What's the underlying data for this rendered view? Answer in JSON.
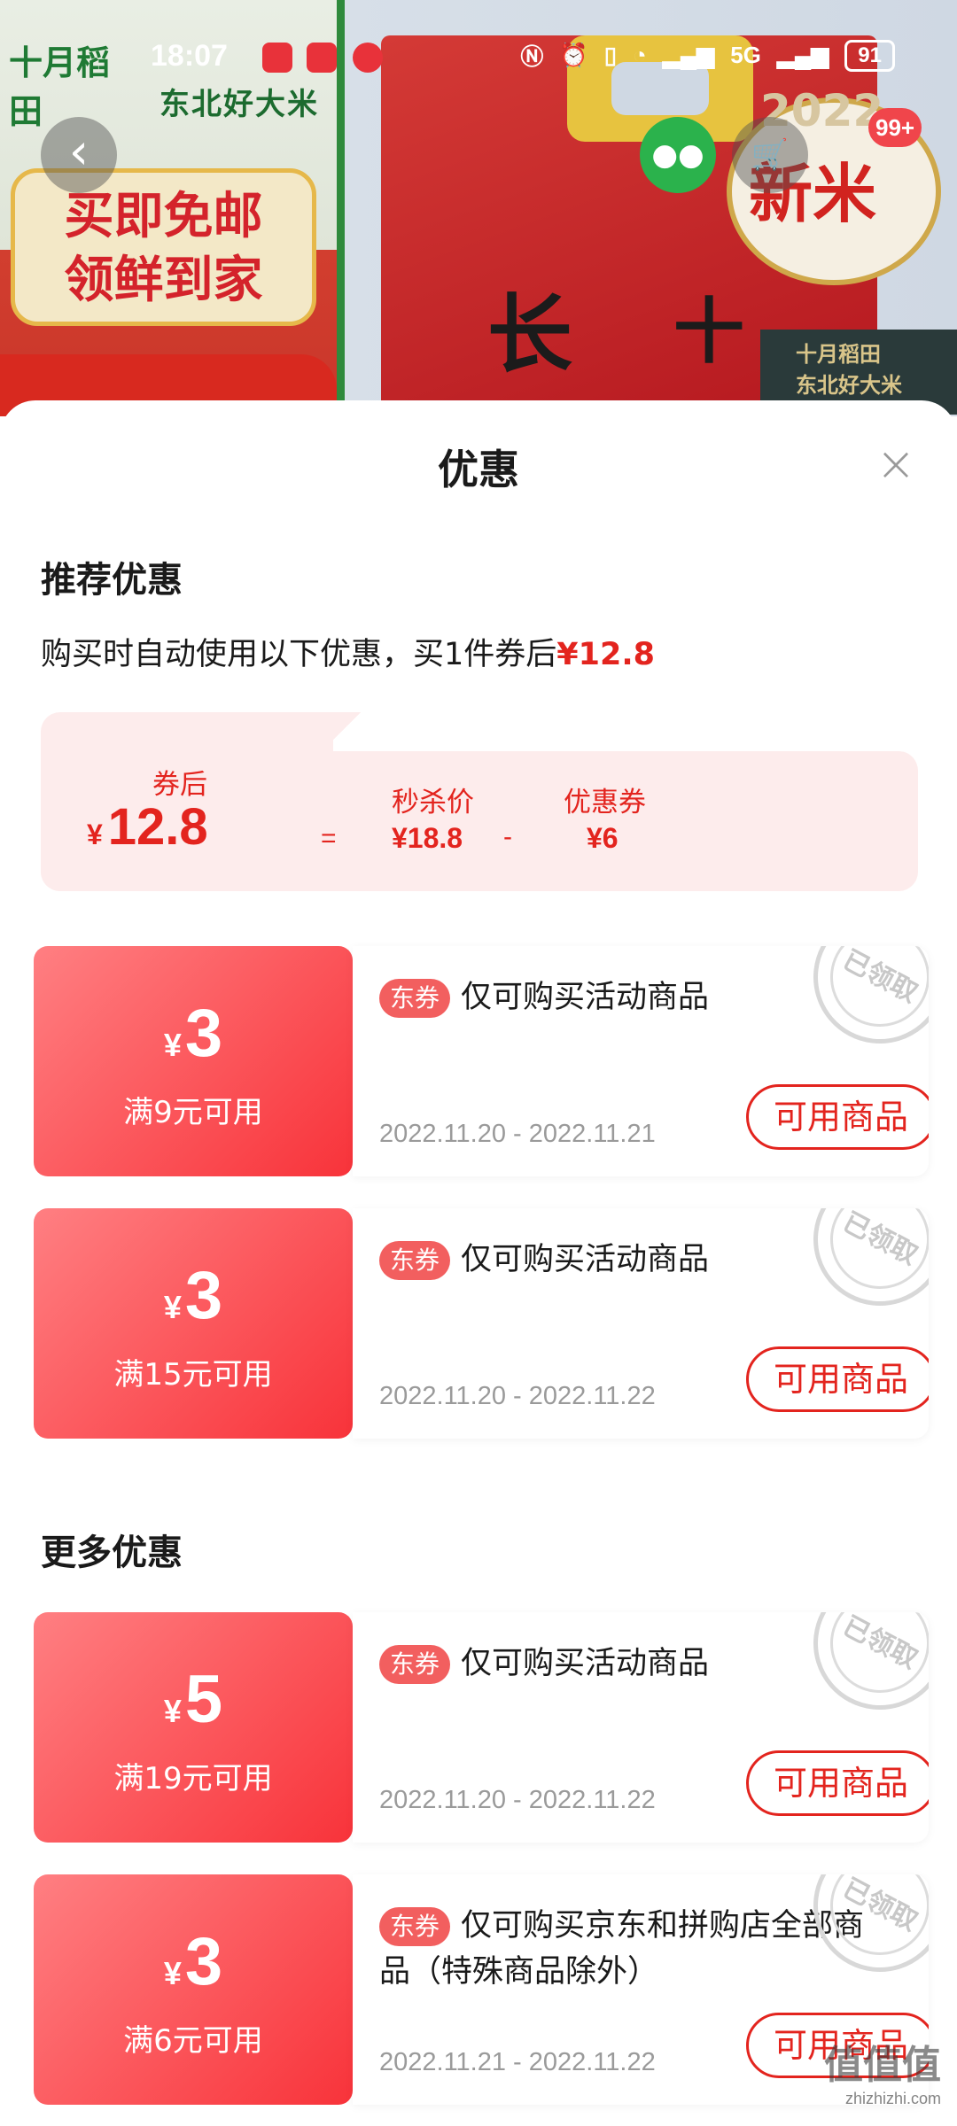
{
  "status_bar": {
    "time": "18:07",
    "network": "5G",
    "battery": "91"
  },
  "product_banner": {
    "brand_name": "十月稻田",
    "brand_tagline": "东北好大米",
    "promo_line1": "买即免邮",
    "promo_line2": "领鲜到家",
    "bag_char1": "十",
    "bag_char2": "长",
    "new_rice_year": "2022",
    "new_rice_label": "新米",
    "mini_card_line1": "十月稻田",
    "mini_card_line2": "东北好大米",
    "cart_badge": "99+"
  },
  "sheet": {
    "title": "优惠",
    "close_label": "×"
  },
  "recommended": {
    "section_title": "推荐优惠",
    "description_prefix": "购买时自动使用以下优惠，买1件券后",
    "description_price": "¥12.8",
    "calc": {
      "after_label": "券后",
      "after_currency": "¥",
      "after_value": "12.8",
      "equals": "=",
      "flash_label": "秒杀价",
      "flash_value": "¥18.8",
      "minus": "-",
      "coupon_label": "优惠券",
      "coupon_value": "¥6"
    }
  },
  "coupons_recommended": [
    {
      "currency": "¥",
      "amount": "3",
      "condition": "满9元可用",
      "tag": "东券",
      "text": "仅可购买活动商品",
      "date": "2022.11.20 - 2022.11.21",
      "button": "可用商品",
      "stamp": "已领取"
    },
    {
      "currency": "¥",
      "amount": "3",
      "condition": "满15元可用",
      "tag": "东券",
      "text": "仅可购买活动商品",
      "date": "2022.11.20 - 2022.11.22",
      "button": "可用商品",
      "stamp": "已领取"
    }
  ],
  "more": {
    "section_title": "更多优惠"
  },
  "coupons_more": [
    {
      "currency": "¥",
      "amount": "5",
      "condition": "满19元可用",
      "tag": "东券",
      "text": "仅可购买活动商品",
      "date": "2022.11.20 - 2022.11.22",
      "button": "可用商品",
      "stamp": "已领取"
    },
    {
      "currency": "¥",
      "amount": "3",
      "condition": "满6元可用",
      "tag": "东券",
      "text": "仅可购买京东和拼购店全部商品（特殊商品除外）",
      "date": "2022.11.21 - 2022.11.22",
      "button": "可用商品",
      "stamp": "已领取"
    }
  ],
  "watermark": {
    "main": "值值值",
    "sub": "zhizhizhi.com"
  },
  "colors": {
    "accent_red": "#e3241e",
    "coupon_gradient_start": "#ff7f82",
    "coupon_gradient_end": "#f8333a",
    "calc_bg": "#fdecec"
  }
}
